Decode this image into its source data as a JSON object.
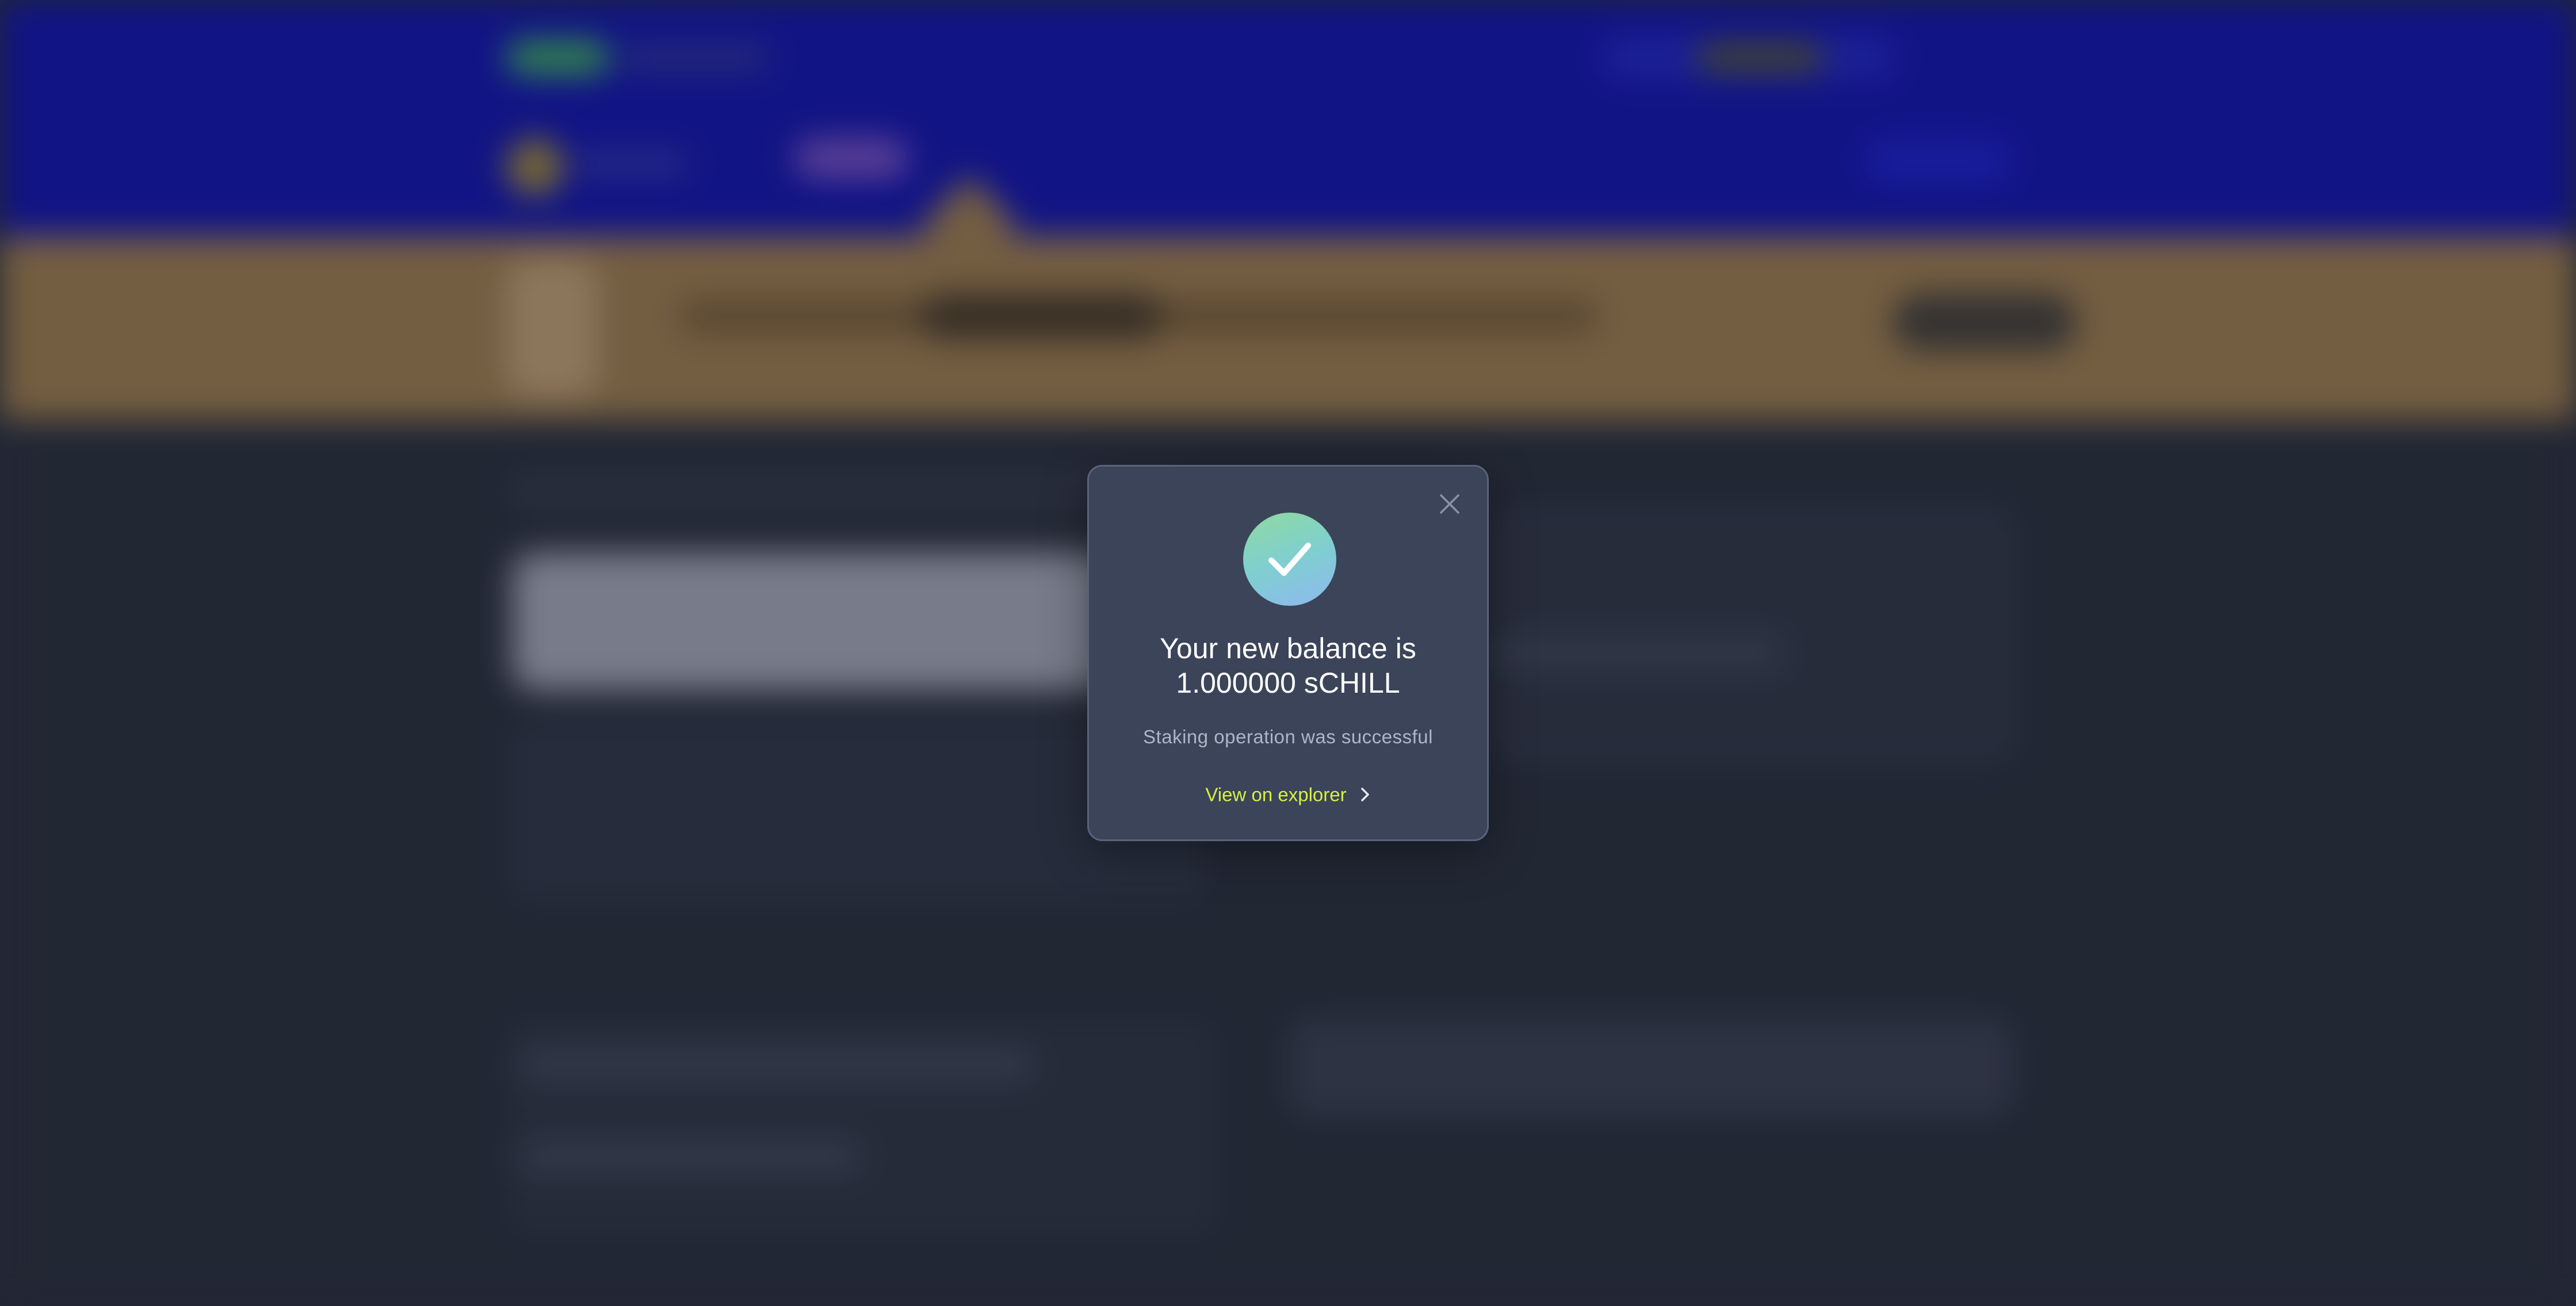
{
  "modal": {
    "title_line1": "Your new balance is",
    "title_line2": "1.000000 sCHILL",
    "subtitle": "Staking operation was successful",
    "explorer_link": "View on explorer",
    "icons": {
      "close": "close-icon",
      "success": "checkmark-icon",
      "link_arrow": "chevron-right-icon"
    }
  },
  "colors": {
    "header_bg": "#12159c",
    "banner_bg": "#8a6f4a",
    "page_bg": "#262c3a",
    "modal_bg": "#3b4459",
    "link_accent": "#d6f043",
    "success_gradient_start": "#8fd9a0",
    "success_gradient_end": "#8fb8f0"
  }
}
